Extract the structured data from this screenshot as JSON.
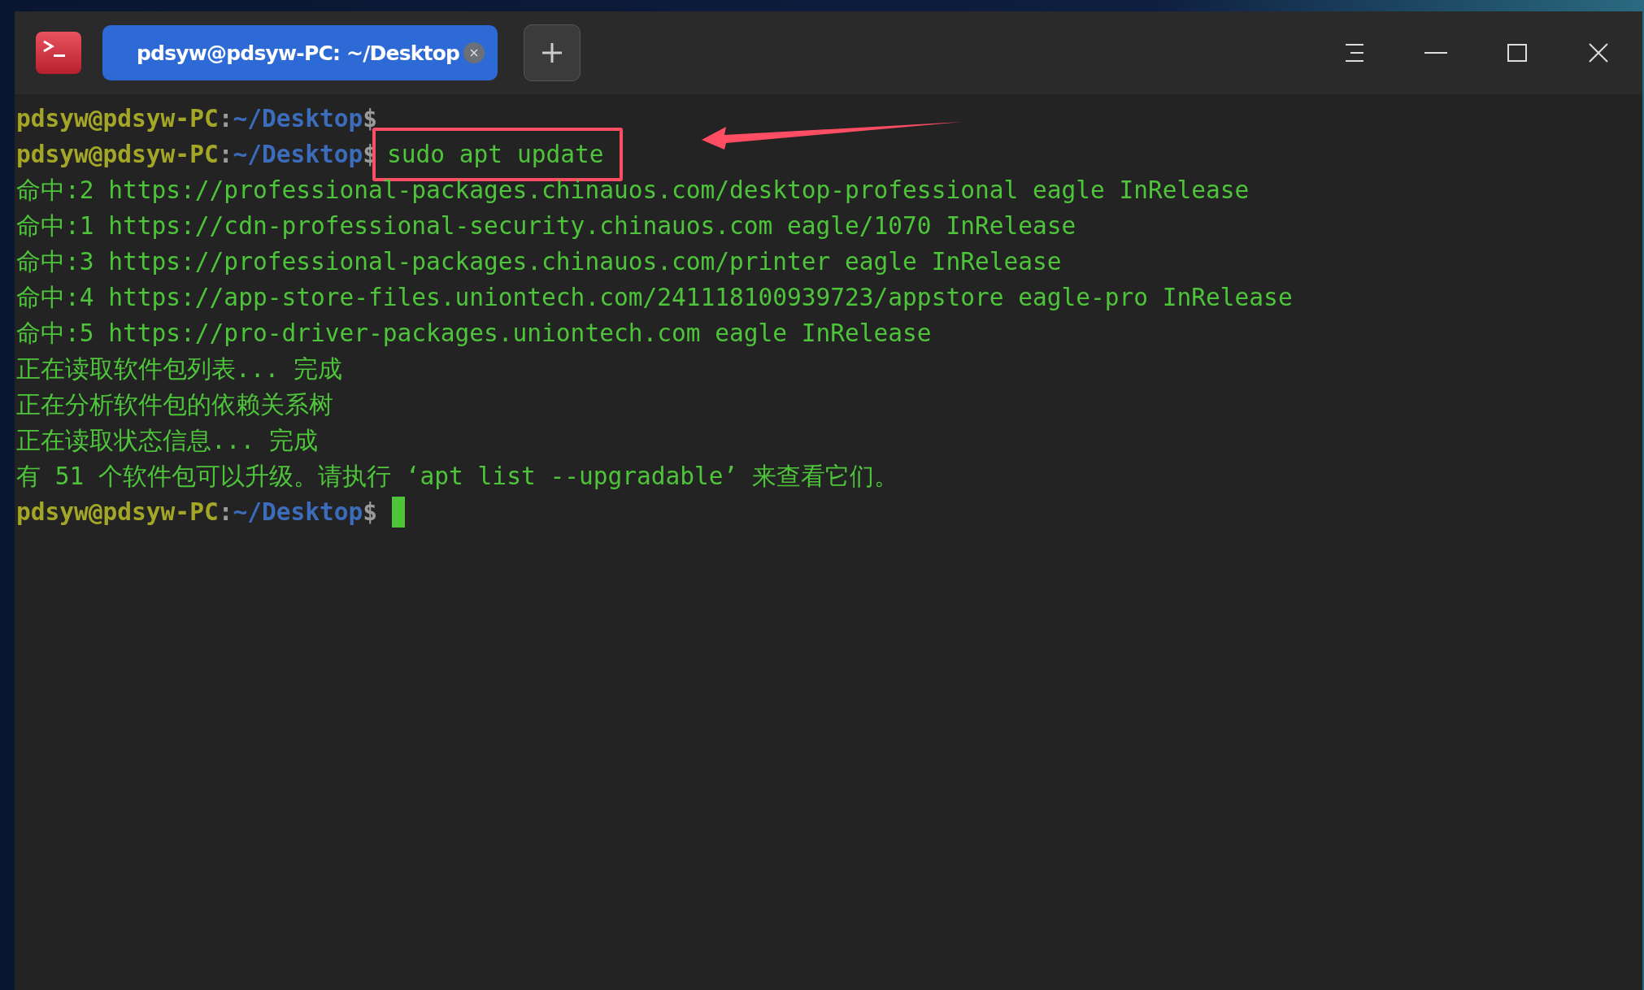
{
  "window": {
    "tab": {
      "title": "pdsyw@pdsyw-PC: ~/Desktop",
      "selected": true
    }
  },
  "lines": [
    {
      "kind": "prompt",
      "user": "pdsyw@pdsyw-PC",
      "separator": ":",
      "path": "~/Desktop",
      "symbol": "$"
    },
    {
      "kind": "prompt",
      "user": "pdsyw@pdsyw-PC",
      "separator": ":",
      "path": "~/Desktop",
      "symbol": "$",
      "command": "sudo apt update",
      "marked": true
    },
    {
      "kind": "output",
      "text": "命中:2 https://professional-packages.chinauos.com/desktop-professional eagle InRelease"
    },
    {
      "kind": "output",
      "text": "命中:1 https://cdn-professional-security.chinauos.com eagle/1070 InRelease"
    },
    {
      "kind": "output",
      "text": "命中:3 https://professional-packages.chinauos.com/printer eagle InRelease"
    },
    {
      "kind": "output",
      "text": "命中:4 https://app-store-files.uniontech.com/241118100939723/appstore eagle-pro InRelease"
    },
    {
      "kind": "output",
      "text": "命中:5 https://pro-driver-packages.uniontech.com eagle InRelease"
    },
    {
      "kind": "output",
      "text": "正在读取软件包列表... 完成"
    },
    {
      "kind": "output",
      "text": "正在分析软件包的依赖关系树"
    },
    {
      "kind": "output",
      "text": "正在读取状态信息... 完成"
    },
    {
      "kind": "output",
      "text": "有 51 个软件包可以升级。请执行 ‘apt list --upgradable’ 来查看它们。"
    },
    {
      "kind": "prompt",
      "user": "pdsyw@pdsyw-PC",
      "separator": ":",
      "path": "~/Desktop",
      "symbol": "$",
      "cursor": true
    }
  ]
}
